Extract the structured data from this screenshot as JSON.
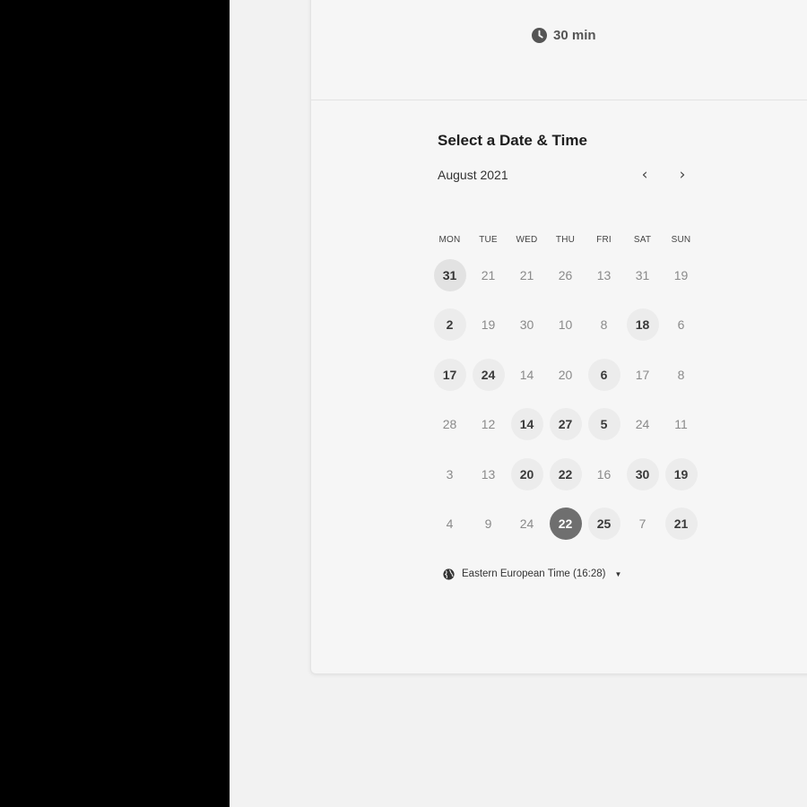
{
  "event": {
    "duration": "30 min"
  },
  "scheduler": {
    "title": "Select a Date & Time",
    "month_label": "August 2021",
    "prev_label": "‹",
    "next_label": "›",
    "weekdays": [
      "MON",
      "TUE",
      "WED",
      "THU",
      "FRI",
      "SAT",
      "SUN"
    ],
    "weeks": [
      [
        {
          "label": "31",
          "state": "today"
        },
        {
          "label": "21",
          "state": "unavailable"
        },
        {
          "label": "21",
          "state": "unavailable"
        },
        {
          "label": "26",
          "state": "unavailable"
        },
        {
          "label": "13",
          "state": "unavailable"
        },
        {
          "label": "31",
          "state": "unavailable"
        },
        {
          "label": "19",
          "state": "unavailable"
        }
      ],
      [
        {
          "label": "2",
          "state": "available"
        },
        {
          "label": "19",
          "state": "unavailable"
        },
        {
          "label": "30",
          "state": "unavailable"
        },
        {
          "label": "10",
          "state": "unavailable"
        },
        {
          "label": "8",
          "state": "unavailable"
        },
        {
          "label": "18",
          "state": "available"
        },
        {
          "label": "6",
          "state": "unavailable"
        }
      ],
      [
        {
          "label": "17",
          "state": "available"
        },
        {
          "label": "24",
          "state": "available"
        },
        {
          "label": "14",
          "state": "unavailable"
        },
        {
          "label": "20",
          "state": "unavailable"
        },
        {
          "label": "6",
          "state": "available"
        },
        {
          "label": "17",
          "state": "unavailable"
        },
        {
          "label": "8",
          "state": "unavailable"
        }
      ],
      [
        {
          "label": "28",
          "state": "unavailable"
        },
        {
          "label": "12",
          "state": "unavailable"
        },
        {
          "label": "14",
          "state": "available"
        },
        {
          "label": "27",
          "state": "available"
        },
        {
          "label": "5",
          "state": "available"
        },
        {
          "label": "24",
          "state": "unavailable"
        },
        {
          "label": "11",
          "state": "unavailable"
        }
      ],
      [
        {
          "label": "3",
          "state": "unavailable"
        },
        {
          "label": "13",
          "state": "unavailable"
        },
        {
          "label": "20",
          "state": "available"
        },
        {
          "label": "22",
          "state": "available"
        },
        {
          "label": "16",
          "state": "unavailable"
        },
        {
          "label": "30",
          "state": "available"
        },
        {
          "label": "19",
          "state": "available"
        }
      ],
      [
        {
          "label": "4",
          "state": "unavailable"
        },
        {
          "label": "9",
          "state": "unavailable"
        },
        {
          "label": "24",
          "state": "unavailable"
        },
        {
          "label": "22",
          "state": "selected"
        },
        {
          "label": "25",
          "state": "available"
        },
        {
          "label": "7",
          "state": "unavailable"
        },
        {
          "label": "21",
          "state": "available"
        }
      ]
    ],
    "timezone_label": "Eastern European Time (16:28)",
    "timezone_caret": "▼"
  },
  "colors": {
    "backdrop": "#000000",
    "page": "#f2f2f2",
    "card": "#f6f6f6",
    "available_day_bg": "#ececec",
    "selected_day_bg": "#6f6f6f",
    "unavailable_day_text": "#8a8a8a"
  },
  "icons": {
    "duration": "clock-icon",
    "timezone": "globe-icon",
    "prev": "chevron-left-icon",
    "next": "chevron-right-icon"
  }
}
